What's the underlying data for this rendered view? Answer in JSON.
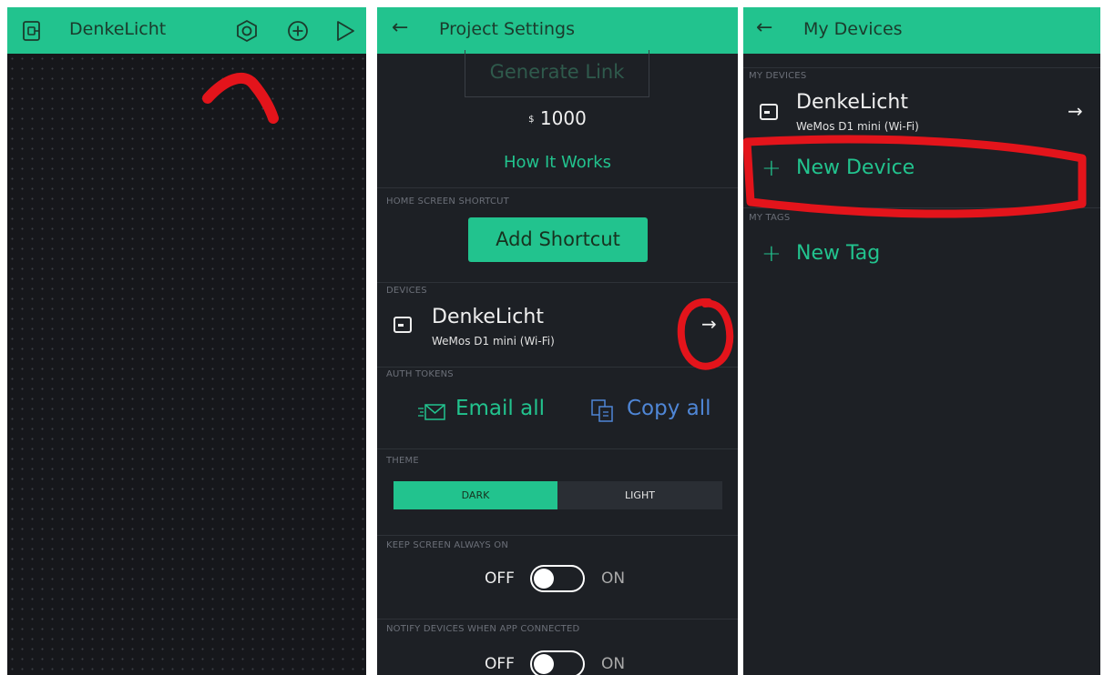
{
  "panel1": {
    "title": "DenkeLicht",
    "icons": [
      "device-icon",
      "hexagon-settings-icon",
      "add-circle-icon",
      "play-icon"
    ]
  },
  "panel2": {
    "title": "Project Settings",
    "generate_link": "Generate Link",
    "price_symbol": "$",
    "price": "1000",
    "how_it_works": "How It Works",
    "home_shortcut_label": "HOME SCREEN SHORTCUT",
    "add_shortcut": "Add Shortcut",
    "devices_label": "DEVICES",
    "device": {
      "name": "DenkeLicht",
      "model": "WeMos D1 mini (Wi-Fi)"
    },
    "auth_label": "AUTH TOKENS",
    "email_all": "Email all",
    "copy_all": "Copy all",
    "theme_label": "THEME",
    "theme_dark": "DARK",
    "theme_light": "LIGHT",
    "theme_selected": "DARK",
    "keep_screen_label": "KEEP SCREEN ALWAYS ON",
    "notify_label": "NOTIFY DEVICES WHEN APP CONNECTED",
    "off": "OFF",
    "on": "ON"
  },
  "panel3": {
    "title": "My Devices",
    "my_devices_label": "MY DEVICES",
    "device": {
      "name": "DenkeLicht",
      "model": "WeMos D1 mini (Wi-Fi)"
    },
    "new_device": "New Device",
    "my_tags_label": "MY TAGS",
    "new_tag": "New Tag"
  },
  "colors": {
    "accent": "#22c38e",
    "annotation": "#e3141b",
    "background": "#1d2025"
  }
}
